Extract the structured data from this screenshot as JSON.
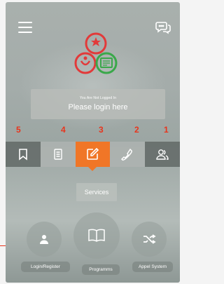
{
  "header": {
    "menu_icon": "hamburger-menu-icon",
    "chat_icon": "chat-bubbles-icon"
  },
  "login": {
    "status": "You Are Not Logged In",
    "prompt": "Please login here"
  },
  "annotations": [
    "5",
    "4",
    "3",
    "2",
    "1"
  ],
  "tabs": [
    {
      "icon": "bookmark-icon"
    },
    {
      "icon": "document-icon"
    },
    {
      "icon": "edit-icon",
      "active": true
    },
    {
      "icon": "phone-icon"
    },
    {
      "icon": "users-icon"
    }
  ],
  "services": {
    "label": "Services"
  },
  "actions": [
    {
      "icon": "user-icon",
      "label": "Login/Register"
    },
    {
      "icon": "book-icon",
      "label": "Programms"
    },
    {
      "icon": "shuffle-icon",
      "label": "Appel System"
    }
  ],
  "colors": {
    "accent": "#f07627",
    "annotation": "#e8341c",
    "logo_red": "#e23a3a",
    "logo_green": "#3aa84a"
  }
}
